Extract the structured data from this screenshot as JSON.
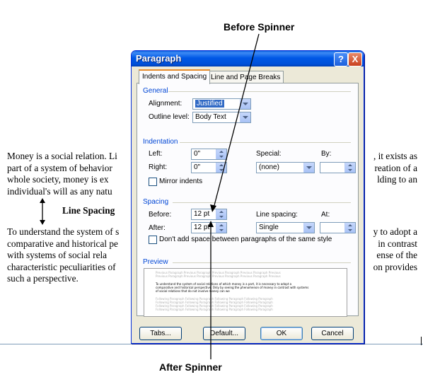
{
  "callouts": {
    "before_spinner": "Before Spinner",
    "after_spinner": "After Spinner"
  },
  "document": {
    "paragraph1": [
      {
        "left": "Money is a social relation. Li",
        "right": ", it exists as"
      },
      {
        "left": "part of a system of behavior",
        "right": "reation of a"
      },
      {
        "left": "whole society, money is ex",
        "right": "lding to an"
      },
      {
        "left": "individual's will as any natu",
        "right": ""
      }
    ],
    "line_spacing_label": "Line Spacing",
    "paragraph2": [
      {
        "left": "To understand the system of s",
        "right": "y to adopt a"
      },
      {
        "left": "comparative and historical pe",
        "right": "in contrast"
      },
      {
        "left": "with systems of social rela",
        "right": "ense of the"
      },
      {
        "left": "characteristic peculiarities of",
        "right": "on provides"
      },
      {
        "left": "such a perspective.",
        "right": ""
      }
    ]
  },
  "dialog": {
    "title": "Paragraph",
    "help_glyph": "?",
    "close_glyph": "X",
    "tabs": [
      {
        "label": "Indents and Spacing",
        "active": true
      },
      {
        "label": "Line and Page Breaks",
        "active": false
      }
    ],
    "general": {
      "section_title": "General",
      "alignment_label": "Alignment:",
      "alignment_value": "Justified",
      "outline_label": "Outline level:",
      "outline_value": "Body Text"
    },
    "indentation": {
      "section_title": "Indentation",
      "left_label": "Left:",
      "left_value": "0\"",
      "right_label": "Right:",
      "right_value": "0\"",
      "special_label": "Special:",
      "special_value": "(none)",
      "by_label": "By:",
      "by_value": "",
      "mirror_label": "Mirror indents",
      "mirror_checked": false
    },
    "spacing": {
      "section_title": "Spacing",
      "before_label": "Before:",
      "before_value": "12 pt",
      "after_label": "After:",
      "after_value": "12 pt",
      "line_spacing_label": "Line spacing:",
      "line_spacing_value": "Single",
      "at_label": "At:",
      "at_value": "",
      "dont_add_label": "Don't add space between paragraphs of the same style",
      "dont_add_checked": false
    },
    "preview": {
      "section_title": "Preview",
      "before_text": "Previous Paragraph Previous Paragraph Previous Paragraph Previous Paragraph Previous",
      "sample_text_1": "To understand the system of social relations of which money is a part, it is necessary to adopt a",
      "sample_text_2": "comparative and historical perspective. Only by seeing the phenomenon of money in contrast with systems",
      "sample_text_3": "of social relations that do not involve money can we",
      "after_text": "Following Paragraph Following Paragraph Following Paragraph Following Paragraph"
    },
    "buttons": {
      "tabs": "Tabs...",
      "default": "Default...",
      "ok": "OK",
      "cancel": "Cancel"
    }
  },
  "colors": {
    "titlebar": "#0058e6",
    "dialog_bg": "#ece9d8",
    "section_title": "#0046d5",
    "selection": "#316ac5"
  }
}
